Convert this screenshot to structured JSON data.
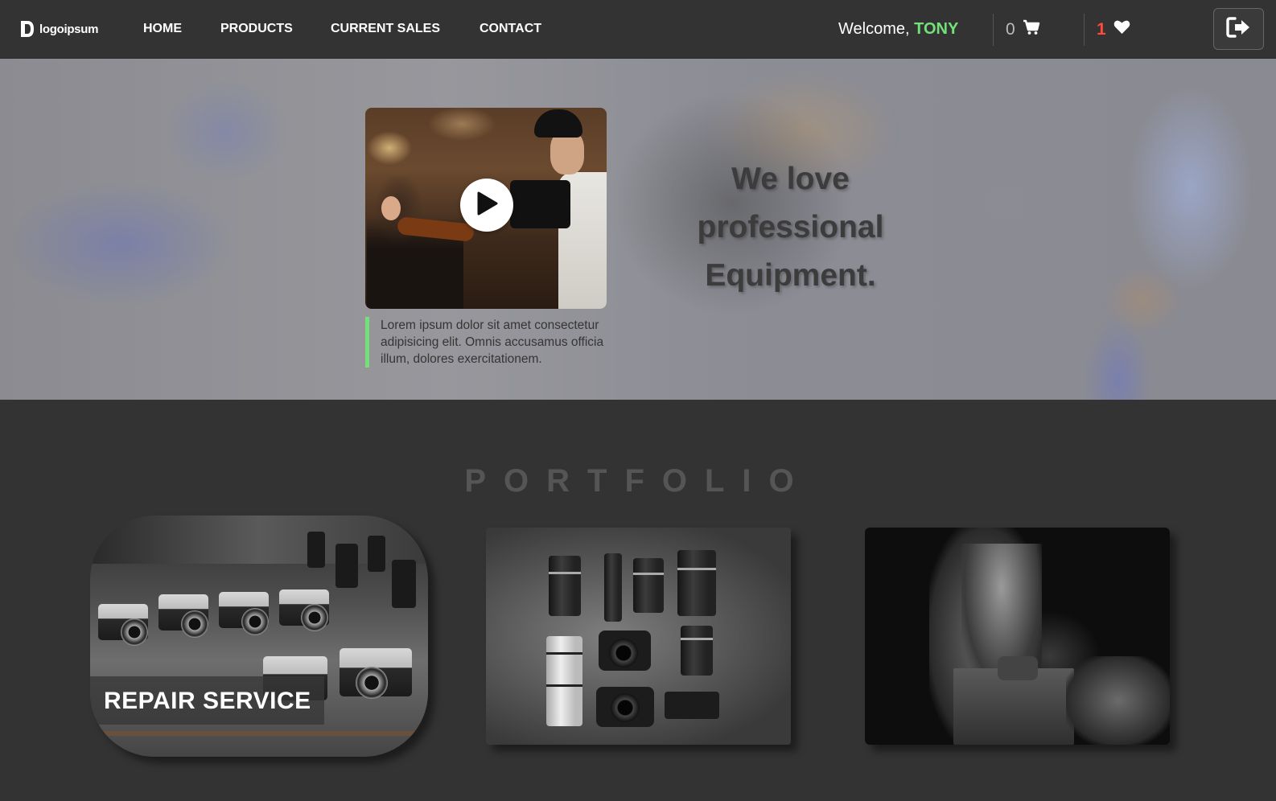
{
  "brand": {
    "logo_text": "logoipsum",
    "logo_mark": "®"
  },
  "nav": {
    "links": [
      {
        "label": "HOME"
      },
      {
        "label": "PRODUCTS"
      },
      {
        "label": "CURRENT SALES"
      },
      {
        "label": "CONTACT"
      }
    ]
  },
  "user": {
    "welcome_prefix": "Welcome,",
    "name": "TONY"
  },
  "cart": {
    "count": "0",
    "icon": "cart-icon"
  },
  "wishlist": {
    "count": "1",
    "icon": "heart-icon"
  },
  "logout": {
    "icon": "sign-out-icon"
  },
  "hero": {
    "title_lines": [
      "We love",
      "professional",
      "Equipment."
    ],
    "caption": "Lorem ipsum dolor sit amet consectetur adipisicing elit. Omnis accusamus officia illum, dolores exercitationem.",
    "play_icon": "play-icon"
  },
  "portfolio": {
    "title": "PORTFOLIO",
    "cards": [
      {
        "label": "REPAIR SERVICE"
      },
      {
        "label": ""
      },
      {
        "label": ""
      }
    ]
  },
  "colors": {
    "background": "#333333",
    "accent_green": "#74e07a",
    "wishlist_red": "#ff4a3d",
    "portfolio_title": "#555555"
  }
}
